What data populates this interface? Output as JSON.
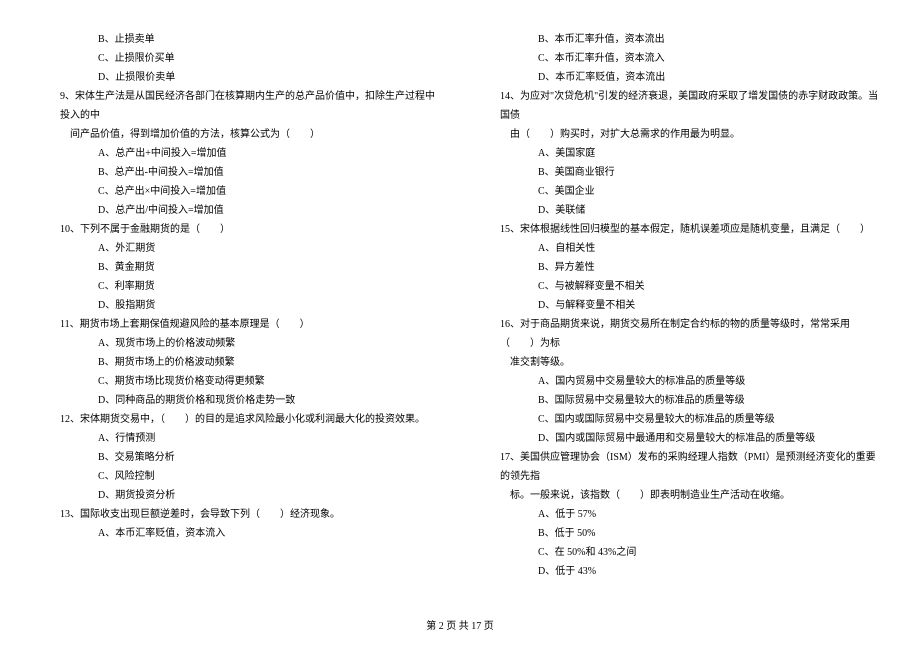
{
  "left_column": {
    "q8_options": {
      "b": "B、止损卖单",
      "c": "C、止损限价买单",
      "d": "D、止损限价卖单"
    },
    "q9": {
      "text": "9、宋体生产法是从国民经济各部门在核算期内生产的总产品价值中，扣除生产过程中投入的中",
      "text2": "间产品价值，得到增加价值的方法，核算公式为（　　）",
      "a": "A、总产出+中间投入=增加值",
      "b": "B、总产出-中间投入=增加值",
      "c": "C、总产出×中间投入=增加值",
      "d": "D、总产出/中间投入=增加值"
    },
    "q10": {
      "text": "10、下列不属于金融期货的是（　　）",
      "a": "A、外汇期货",
      "b": "B、黄金期货",
      "c": "C、利率期货",
      "d": "D、股指期货"
    },
    "q11": {
      "text": "11、期货市场上套期保值规避风险的基本原理是（　　）",
      "a": "A、现货市场上的价格波动频繁",
      "b": "B、期货市场上的价格波动频繁",
      "c": "C、期货市场比现货价格变动得更频繁",
      "d": "D、同种商品的期货价格和现货价格走势一致"
    },
    "q12": {
      "text": "12、宋体期货交易中，（　　）的目的是追求风险最小化或利润最大化的投资效果。",
      "a": "A、行情预测",
      "b": "B、交易策略分析",
      "c": "C、风险控制",
      "d": "D、期货投资分析"
    },
    "q13": {
      "text": "13、国际收支出现巨额逆差时，会导致下列（　　）经济现象。",
      "a": "A、本币汇率贬值，资本流入"
    }
  },
  "right_column": {
    "q13_options": {
      "b": "B、本币汇率升值，资本流出",
      "c": "C、本币汇率升值，资本流入",
      "d": "D、本币汇率贬值，资本流出"
    },
    "q14": {
      "text": "14、为应对\"次贷危机\"引发的经济衰退，美国政府采取了增发国债的赤字财政政策。当国债",
      "text2": "由（　　）购买时，对扩大总需求的作用最为明显。",
      "a": "A、美国家庭",
      "b": "B、美国商业银行",
      "c": "C、美国企业",
      "d": "D、美联储"
    },
    "q15": {
      "text": "15、宋体根据线性回归模型的基本假定，随机误差项应是随机变量，且满足（　　）",
      "a": "A、自相关性",
      "b": "B、异方差性",
      "c": "C、与被解释变量不相关",
      "d": "D、与解释变量不相关"
    },
    "q16": {
      "text": "16、对于商品期货来说，期货交易所在制定合约标的物的质量等级时，常常采用（　　）为标",
      "text2": "准交割等级。",
      "a": "A、国内贸易中交易量较大的标准品的质量等级",
      "b": "B、国际贸易中交易量较大的标准品的质量等级",
      "c": "C、国内或国际贸易中交易量较大的标准品的质量等级",
      "d": "D、国内或国际贸易中最通用和交易量较大的标准品的质量等级"
    },
    "q17": {
      "text": "17、美国供应管理协会（ISM）发布的采购经理人指数（PMI）是预测经济变化的重要的领先指",
      "text2": "标。一般来说，该指数（　　）即表明制造业生产活动在收缩。",
      "a": "A、低于 57%",
      "b": "B、低于 50%",
      "c": "C、在 50%和 43%之间",
      "d": "D、低于 43%"
    }
  },
  "footer": "第 2 页 共 17 页"
}
